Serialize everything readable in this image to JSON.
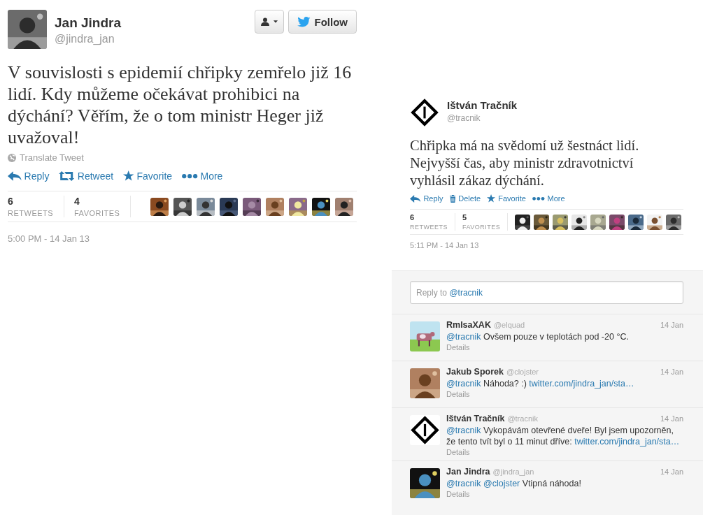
{
  "main_tweet": {
    "author": {
      "name": "Jan Jindra",
      "handle": "@jindra_jan",
      "avatar": {
        "kind": "picture"
      }
    },
    "buttons": [
      {
        "kind": "user-menu"
      },
      {
        "kind": "follow",
        "label": "Follow"
      }
    ],
    "text": "V souvislosti s epidemií chřipky zemřelo již 16 lidí. Kdy můžeme očekávat prohibici na dýchání? Věřím, že o tom ministr Heger již uvažoval!",
    "translate": "Translate Tweet",
    "actions": [
      {
        "kind": "reply",
        "label": "Reply"
      },
      {
        "kind": "retweet",
        "label": "Retweet"
      },
      {
        "kind": "favorite",
        "label": "Favorite"
      },
      {
        "kind": "more",
        "label": "More"
      }
    ],
    "stats": [
      {
        "count": "6",
        "label": "RETWEETS"
      },
      {
        "count": "4",
        "label": "FAVORITES"
      }
    ],
    "faces": [
      {
        "kind": "picture"
      },
      {
        "kind": "picture"
      },
      {
        "kind": "picture"
      },
      {
        "kind": "picture"
      },
      {
        "kind": "picture"
      },
      {
        "kind": "picture"
      },
      {
        "kind": "picture"
      },
      {
        "kind": "picture"
      },
      {
        "kind": "picture"
      }
    ],
    "time": "5:00 PM - 14 Jan 13"
  },
  "own_tweet": {
    "author": {
      "name": "Ištván Tračník",
      "handle": "@tracnik",
      "avatar": {
        "kind": "logo"
      }
    },
    "text": "Chřipka má na svědomí už šestnáct lidí. Nejvyšší čas, aby ministr zdravotnictví vyhlásil zákaz dýchání.",
    "actions": [
      {
        "kind": "reply",
        "label": "Reply"
      },
      {
        "kind": "delete",
        "label": "Delete"
      },
      {
        "kind": "favorite",
        "label": "Favorite"
      },
      {
        "kind": "more",
        "label": "More"
      }
    ],
    "stats": [
      {
        "count": "6",
        "label": "RETWEETS"
      },
      {
        "count": "5",
        "label": "FAVORITES"
      }
    ],
    "faces": [
      {
        "kind": "picture"
      },
      {
        "kind": "picture"
      },
      {
        "kind": "picture"
      },
      {
        "kind": "picture"
      },
      {
        "kind": "picture"
      },
      {
        "kind": "picture"
      },
      {
        "kind": "picture"
      },
      {
        "kind": "picture"
      },
      {
        "kind": "picture"
      }
    ],
    "time": "5:11 PM - 14 Jan 13"
  },
  "reply_box": {
    "placeholder": "Reply to",
    "placeholder_mention": "@tracnik"
  },
  "replies": [
    {
      "name": "RmIsaXAK",
      "handle": "@elquad",
      "date": "14 Jan",
      "avatar": {
        "kind": "picture"
      },
      "text": [
        {
          "kind": "mention",
          "text": "@tracnik"
        },
        {
          "kind": "text",
          "text": "Ovšem pouze v teplotách pod -20 °C."
        }
      ],
      "details": "Details"
    },
    {
      "name": "Jakub Sporek",
      "handle": "@clojster",
      "date": "14 Jan",
      "avatar": {
        "kind": "picture"
      },
      "text": [
        {
          "kind": "mention",
          "text": "@tracnik"
        },
        {
          "kind": "text",
          "text": "Náhoda? :)"
        },
        {
          "kind": "link",
          "text": "twitter.com/jindra_jan/sta…"
        }
      ],
      "details": "Details"
    },
    {
      "name": "Ištván Tračník",
      "handle": "@tracnik",
      "date": "14 Jan",
      "avatar": {
        "kind": "logo"
      },
      "text": [
        {
          "kind": "mention",
          "text": "@tracnik"
        },
        {
          "kind": "text",
          "text": "Vykopávám otevřené dveře! Byl jsem upozorněn, že tento tvít byl o 11 minut dříve:"
        },
        {
          "kind": "link",
          "text": "twitter.com/jindra_jan/sta…"
        }
      ],
      "details": "Details"
    },
    {
      "name": "Jan Jindra",
      "handle": "@jindra_jan",
      "date": "14 Jan",
      "avatar": {
        "kind": "picture"
      },
      "text": [
        {
          "kind": "mention",
          "text": "@tracnik"
        },
        {
          "kind": "mention",
          "text": "@clojster"
        },
        {
          "kind": "text",
          "text": "Vtipná náhoda!"
        }
      ],
      "details": "Details"
    }
  ]
}
